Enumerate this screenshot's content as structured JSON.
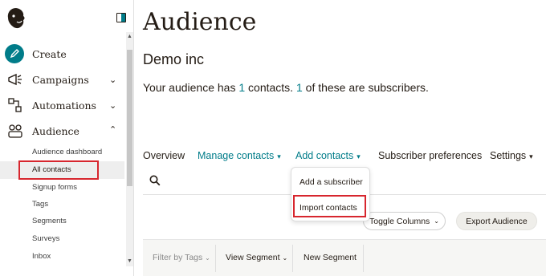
{
  "sidebar": {
    "primary": [
      {
        "label": "Create",
        "icon": "pencil-icon"
      },
      {
        "label": "Campaigns",
        "icon": "megaphone-icon",
        "chevron": "down"
      },
      {
        "label": "Automations",
        "icon": "automation-icon",
        "chevron": "down"
      },
      {
        "label": "Audience",
        "icon": "audience-icon",
        "chevron": "up"
      }
    ],
    "audience_items": [
      "Audience dashboard",
      "All contacts",
      "Signup forms",
      "Tags",
      "Segments",
      "Surveys",
      "Inbox"
    ],
    "selected_item": "All contacts"
  },
  "main": {
    "title": "Audience",
    "org_name": "Demo inc",
    "summary": {
      "prefix": "Your audience has ",
      "contacts": "1",
      "middle": " contacts. ",
      "subscribers": "1",
      "suffix": " of these are subscribers."
    },
    "tabs": [
      {
        "label": "Overview",
        "caret": false
      },
      {
        "label": "Manage contacts",
        "caret": true
      },
      {
        "label": "Add contacts",
        "caret": true
      },
      {
        "label": "Subscriber preferences",
        "caret": false
      },
      {
        "label": "Settings",
        "caret": true
      }
    ],
    "add_contacts_menu": [
      "Add a subscriber",
      "Import contacts"
    ],
    "buttons": {
      "toggle_columns": "Toggle Columns",
      "export_audience": "Export Audience"
    },
    "toolbar": {
      "filter_by_tags": "Filter by Tags",
      "view_segment": "View Segment",
      "new_segment": "New Segment"
    }
  },
  "colors": {
    "accent_teal": "#007c89",
    "highlight_red": "#d7262e",
    "text_dark": "#241c15"
  }
}
